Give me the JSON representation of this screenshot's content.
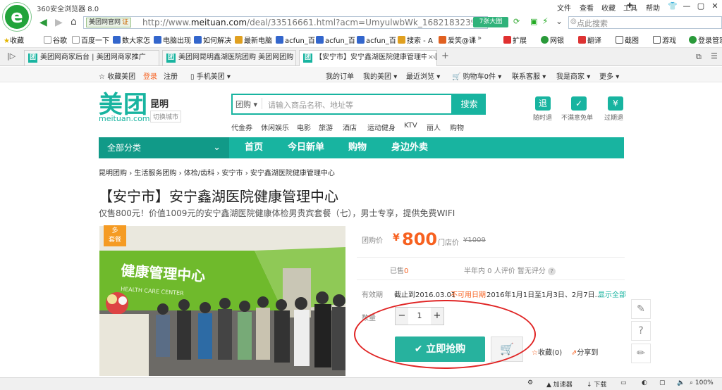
{
  "browser": {
    "title": "360安全浏览器 8.0",
    "menu": [
      "文件",
      "查看",
      "收藏",
      "工具",
      "帮助"
    ],
    "site_tag": "美团网官网",
    "site_tag_badge": "证",
    "url_prefix": "http://www.",
    "url_domain": "meituan.com",
    "url_rest": "/deal/33516661.html?acm=UmyulwbWk_1682183239947",
    "big_btn": "7张大图",
    "search_placeholder": "点此搜索",
    "favorites": [
      "收藏",
      "谷歌",
      "百度一下",
      "数大家怎",
      "电脑出现",
      "如何解决",
      "最新电脑",
      "acfun_百",
      "acfun_百",
      "acfun_百",
      "搜索 - A",
      "爱笑@课"
    ],
    "fav_right": [
      "扩展",
      "网银",
      "翻译",
      "截图",
      "游戏",
      "登录管家"
    ],
    "tabs": [
      {
        "label": "美团网商家后台 | 美团网商家推广",
        "close": "×"
      },
      {
        "label": "美团网昆明鑫湖医院团购 美团网团购",
        "close": "×"
      },
      {
        "label": "【安宁市】安宁鑫湖医院健康管理中心团购】安",
        "close": "×"
      }
    ],
    "status": [
      "加速器",
      "下载",
      "100%"
    ]
  },
  "mt_nav": {
    "left": [
      "收藏美团",
      "登录",
      "注册",
      "手机美团"
    ],
    "right": [
      "我的订单",
      "我的美团",
      "最近浏览",
      "购物车0件",
      "联系客服",
      "我是商家",
      "更多"
    ]
  },
  "header": {
    "logo": "美团",
    "domain": "meituan.com",
    "city": "昆明",
    "switch_city": "切换城市",
    "search_category": "团购",
    "search_placeholder": "请输入商品名称、地址等",
    "search_button": "搜索",
    "hot_keywords": [
      "代金券",
      "休闲娱乐",
      "电影",
      "旅游",
      "酒店",
      "运动健身",
      "KTV",
      "丽人",
      "购物"
    ],
    "guarantees": [
      {
        "icon": "退",
        "label": "随时退"
      },
      {
        "icon": "✓",
        "label": "不满意免单"
      },
      {
        "icon": "¥",
        "label": "过期退"
      }
    ]
  },
  "green_nav": {
    "all_categories": "全部分类",
    "items": [
      "首页",
      "今日新单",
      "购物",
      "身边外卖"
    ]
  },
  "breadcrumb": [
    "昆明团购",
    "生活服务团购",
    "体检/齿科",
    "安宁市",
    "安宁鑫湖医院健康管理中心"
  ],
  "deal": {
    "title": "【安宁市】安宁鑫湖医院健康管理中心",
    "subtitle": "仅售800元！价值1009元的安宁鑫湖医院健康体检男贵宾套餐（七），男士专享，提供免费WIFI",
    "tag_line1": "多",
    "tag_line2": "套餐",
    "photo_sign": "健康管理中心",
    "photo_sign_en": "HEALTH CARE CENTER",
    "price_label": "团购价",
    "currency": "¥",
    "price": "800",
    "store_price_label": "门店价",
    "store_price": "¥1009",
    "sold_label": "已售",
    "sold": "0",
    "reviews": "半年内 0 人评价  暂无评分",
    "valid_label": "有效期",
    "valid_until": "截止到2016.03.01",
    "unavailable_label": "不可用日期",
    "unavailable_dates": "2016年1月1日至1月3日、2月7日...",
    "show_all": "显示全部",
    "qty_label": "数量",
    "qty": "1",
    "buy_button": "立即抢购",
    "favorite": "收藏(0)",
    "share": "分享到"
  }
}
